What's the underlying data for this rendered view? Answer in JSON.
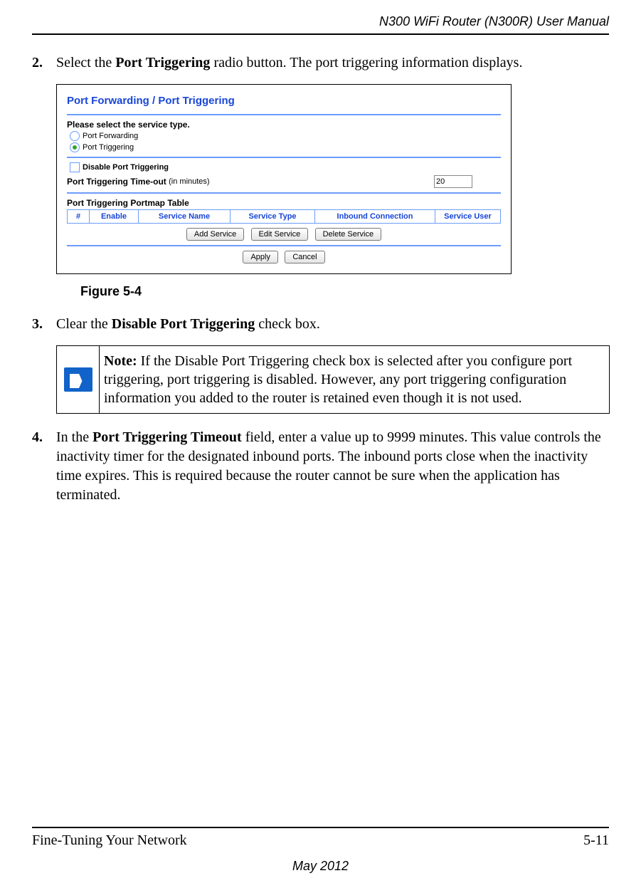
{
  "header": {
    "manual_title": "N300 WiFi Router (N300R) User Manual"
  },
  "steps": {
    "s2": {
      "num": "2.",
      "text_before": "Select the ",
      "bold": "Port Triggering",
      "text_after": " radio button. The port triggering information displays."
    },
    "s3": {
      "num": "3.",
      "text_before": "Clear the ",
      "bold": "Disable Port Triggering",
      "text_after": " check box."
    },
    "s4": {
      "num": "4.",
      "text_before": "In the ",
      "bold": "Port Triggering Timeout",
      "text_after": " field, enter a value up to 9999 minutes. This value controls the inactivity timer for the designated inbound ports. The inbound ports close when the inactivity time expires. This is required because the router cannot be sure when the application has terminated."
    }
  },
  "figure": {
    "panel_title": "Port Forwarding / Port Triggering",
    "select_service_label": "Please select the service type.",
    "radio_forwarding": "Port Forwarding",
    "radio_triggering": "Port Triggering",
    "disable_label": "Disable Port Triggering",
    "timeout_label": "Port Triggering Time-out",
    "timeout_sub": "(in minutes)",
    "timeout_value": "20",
    "portmap_title": "Port Triggering Portmap Table",
    "cols": {
      "num": "#",
      "enable": "Enable",
      "service_name": "Service Name",
      "service_type": "Service Type",
      "inbound": "Inbound Connection",
      "user": "Service User"
    },
    "buttons": {
      "add": "Add Service",
      "edit": "Edit Service",
      "del": "Delete Service",
      "apply": "Apply",
      "cancel": "Cancel"
    },
    "caption": "Figure 5-4"
  },
  "note": {
    "label": "Note:",
    "text": " If the Disable Port Triggering check box is selected after you configure port triggering, port triggering is disabled. However, any port triggering configuration information you added to the router is retained even though it is not used."
  },
  "footer": {
    "section": "Fine-Tuning Your Network",
    "page": "5-11",
    "date": "May 2012"
  }
}
